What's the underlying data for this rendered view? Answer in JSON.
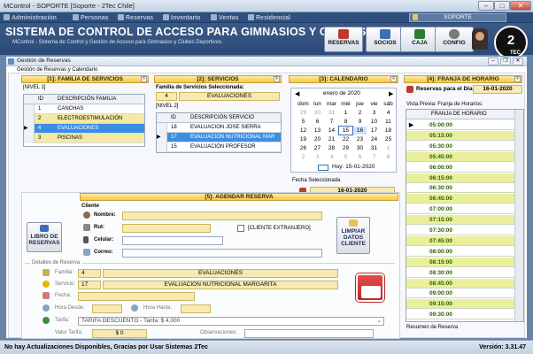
{
  "window": {
    "title": "MControl - SOPORTE [Soporte - 2Tec Chile]"
  },
  "menu": [
    {
      "label": "Administración",
      "icon": "admin-icon"
    },
    {
      "label": "Personas",
      "icon": "people-icon"
    },
    {
      "label": "Reservas",
      "icon": "reservations-icon"
    },
    {
      "label": "Inventario",
      "icon": "inventory-icon"
    },
    {
      "label": "Ventas",
      "icon": "sales-icon"
    },
    {
      "label": "Residencial",
      "icon": "residential-icon"
    }
  ],
  "user": {
    "label": "SOPORTE"
  },
  "app": {
    "title": "SISTEMA DE CONTROL DE ACCESO PARA GIMNASIOS Y CLUBES DEPORTIVO",
    "subtitle": "MControl - Sistema de Control y Gestión de Acceso para Gimnasios y Clubes Deportivos.",
    "logo_text": "2",
    "logo_small": "TEC"
  },
  "toolbar": [
    {
      "label": "RESERVAS",
      "color": "#c0392b"
    },
    {
      "label": "SOCIOS",
      "color": "#3a6fb8"
    },
    {
      "label": "CAJA",
      "color": "#2e7d32"
    },
    {
      "label": "CONFIG",
      "color": "#7b7b7b"
    }
  ],
  "inner": {
    "title": "Gestión de Reservas",
    "section": "Gestión de Reservas y Calendario"
  },
  "familia": {
    "header": "[1]: FAMILIA DE SERVICIOS",
    "level": "[NIVEL 1]",
    "col_id": "ID",
    "col_desc": "DESCRIPCIÓN FAMILIA",
    "rows": [
      {
        "id": "1",
        "desc": "CANCHAS"
      },
      {
        "id": "2",
        "desc": "ELECTROESTIMULACIÓN"
      },
      {
        "id": "4",
        "desc": "EVALUACIONES"
      },
      {
        "id": "3",
        "desc": "PISCINAS"
      }
    ],
    "selected_index": 2
  },
  "servicios": {
    "header": "[2]: SERVICIOS",
    "fam_label": "Familia de Servicios Seleccionada:",
    "fam_id": "4",
    "fam_name": "EVALUACIONES",
    "level": "[NIVEL 2]",
    "col_id": "ID",
    "col_desc": "DESCRIPCIÓN SERVICIO",
    "rows": [
      {
        "id": "18",
        "desc": "EVALUACION JOSE SIERRA"
      },
      {
        "id": "17",
        "desc": "EVALUACION NUTRICIONAL MAR"
      },
      {
        "id": "15",
        "desc": "EVALUACIÓN PROFESOR"
      }
    ],
    "selected_index": 1
  },
  "calendar": {
    "header": "[3]: CALENDARIO",
    "month": "enero de 2020",
    "days": [
      "dom",
      "lun",
      "mar",
      "mié",
      "jue",
      "vie",
      "sáb"
    ],
    "weeks": [
      [
        "29",
        "30",
        "31",
        "1",
        "2",
        "3",
        "4"
      ],
      [
        "5",
        "6",
        "7",
        "8",
        "9",
        "10",
        "11"
      ],
      [
        "12",
        "13",
        "14",
        "15",
        "16",
        "17",
        "18"
      ],
      [
        "19",
        "20",
        "21",
        "22",
        "23",
        "24",
        "25"
      ],
      [
        "26",
        "27",
        "28",
        "29",
        "30",
        "31",
        "1"
      ],
      [
        "2",
        "3",
        "4",
        "5",
        "6",
        "7",
        "8"
      ]
    ],
    "today_label": "Hoy: 15-01-2020",
    "selected_label": "Fecha Seleccionada",
    "selected_date": "16-01-2020"
  },
  "franja": {
    "header": "[4]: FRANJA DE HORARIO",
    "day_label": "Reservas para el Día:",
    "day_value": "16-01-2020",
    "preview_label": "Vista Previa: Franja de Horarios:",
    "col": "FRANJA DE HORARIO",
    "rows": [
      "05:00:00",
      "05:15:00",
      "05:30:00",
      "05:45:00",
      "06:00:00",
      "06:15:00",
      "06:30:00",
      "06:45:00",
      "07:00:00",
      "07:15:00",
      "07:30:00",
      "07:45:00",
      "08:00:00",
      "08:15:00",
      "08:30:00",
      "08:45:00",
      "09:00:00",
      "09:15:00",
      "09:30:00"
    ],
    "summary_label": "Resumen de Reserva"
  },
  "agendar": {
    "header": "[5]: AGENDAR RESERVA",
    "cliente_label": "Cliente",
    "nombre": "Nombre:",
    "rut": "Rut:",
    "celular": "Celular:",
    "correo": "Correo:",
    "extranjero": "[CLIENTE EXTRANJERO]",
    "libro_btn": "LIBRO DE RESERVAS",
    "limpiar_btn": "LIMPIAR DATOS CLIENTE",
    "detalles_label": "Detalles de Reserva",
    "familia_label": "Familia:",
    "familia_id": "4",
    "familia_name": "EVALUACIONES",
    "servicio_label": "Servicio:",
    "servicio_id": "17",
    "servicio_name": "EVALUACION NUTRICIONAL MARGARITA",
    "fecha_label": "Fecha:",
    "hora_desde": "Hora Desde:",
    "hora_hasta": "Hora Hasta:",
    "tarifa_label": "Tarifa:",
    "tarifa_value": "TARIFA DESCUENTO - Tarifa: $ 4,000",
    "valor_label": "Valor Tarifa:",
    "valor_value": "$ 0",
    "obs_label": "Observaciones:"
  },
  "status": {
    "left": "No hay Actualizaciones Disponibles, Gracias por Usar Sistemas 2Tec",
    "right": "Versión: 3.31.47"
  }
}
